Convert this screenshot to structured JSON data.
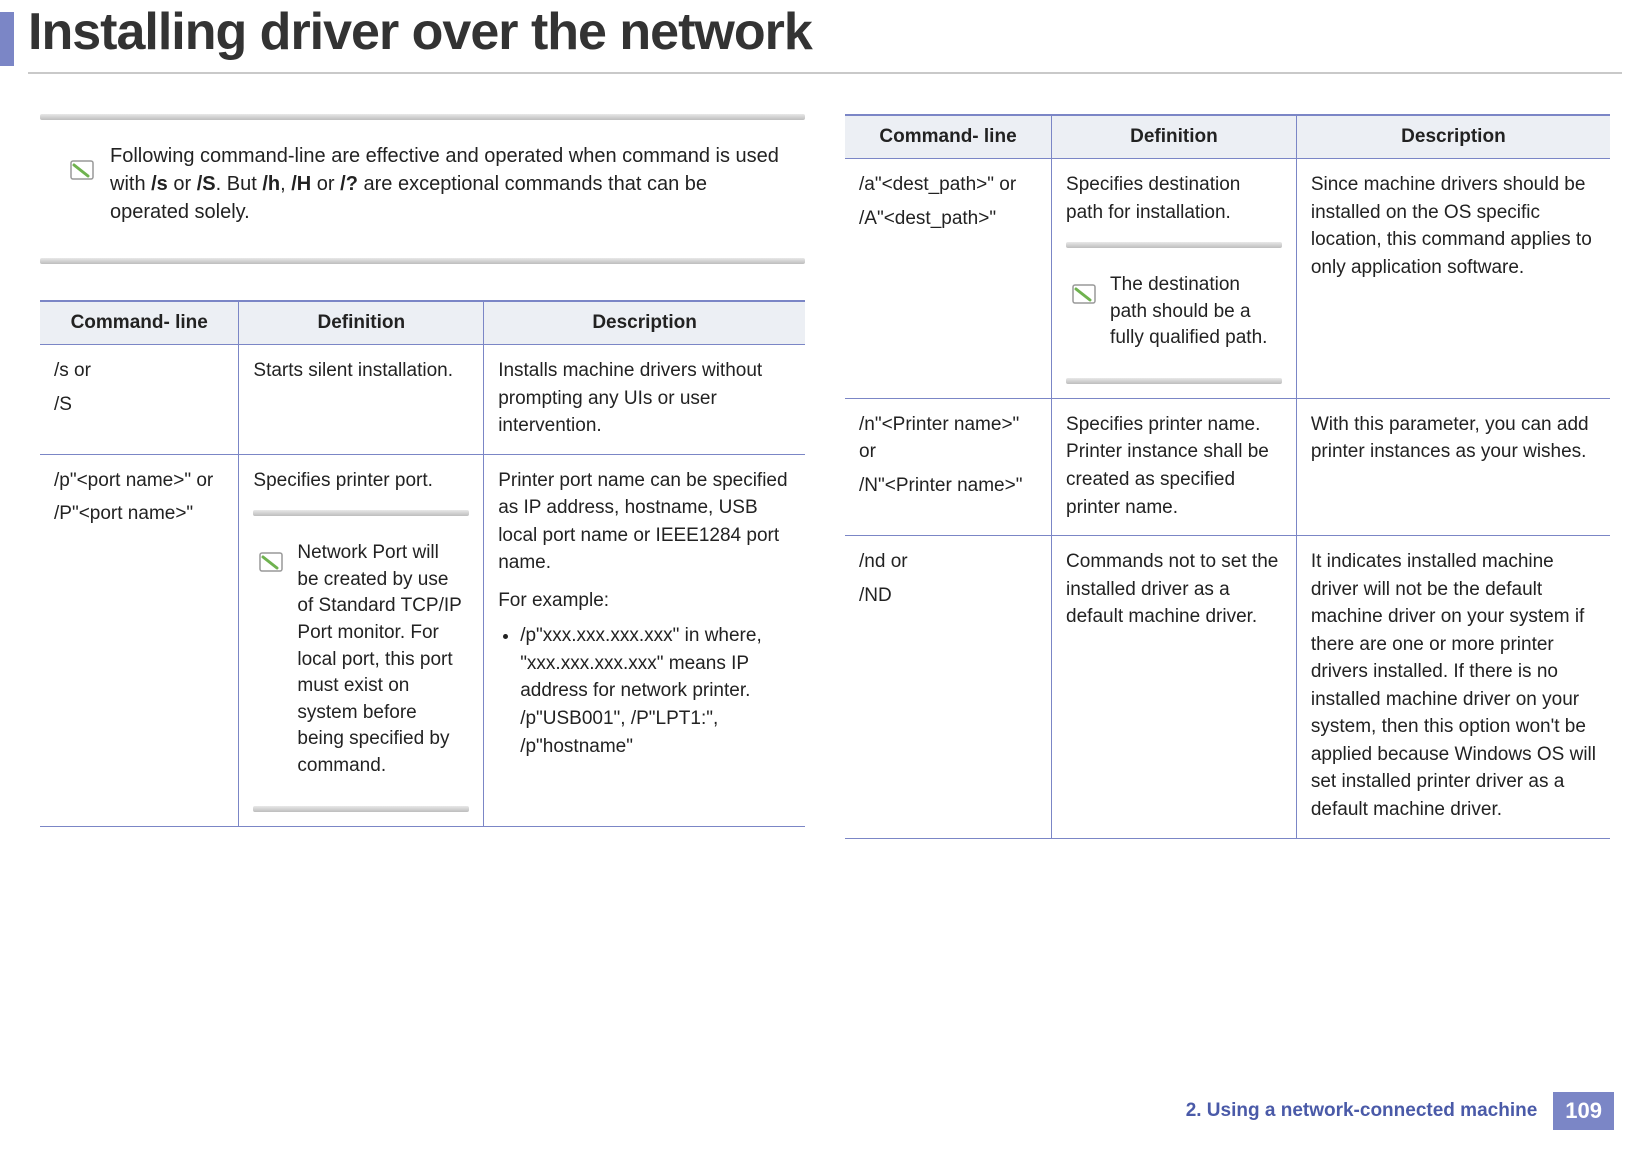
{
  "title": "Installing driver over the network",
  "intro_note": {
    "prefix": "Following command-line are effective and operated when command is used with ",
    "bold1": "/s",
    "mid1": " or ",
    "bold2": "/S",
    "mid2": ". But ",
    "bold3": "/h",
    "mid3": ", ",
    "bold4": "/H",
    "mid4": " or ",
    "bold5": "/?",
    "suffix": " are exceptional commands that can be operated solely."
  },
  "headers": {
    "cmd": "Command- line",
    "def": "Definition",
    "desc": "Description"
  },
  "left_rows": [
    {
      "cmd1": "/s or",
      "cmd2": "/S",
      "def_text": "Starts silent installation.",
      "def_note": null,
      "desc_paras": [
        "Installs machine drivers without prompting any UIs or user intervention."
      ],
      "desc_list": []
    },
    {
      "cmd1": "/p\"<port name>\" or",
      "cmd2": "/P\"<port name>\"",
      "def_text": "Specifies printer port.",
      "def_note": "Network Port will be created by use of Standard TCP/IP Port monitor. For local port, this port must exist on system before being specified by command.",
      "desc_paras": [
        "Printer port name can be specified as IP address, hostname, USB local port name or IEEE1284 port name.",
        "For example:"
      ],
      "desc_list": [
        "/p\"xxx.xxx.xxx.xxx\" in where, \"xxx.xxx.xxx.xxx\" means IP address for network printer. /p\"USB001\", /P\"LPT1:\", /p\"hostname\""
      ]
    }
  ],
  "right_rows": [
    {
      "cmd1": "/a\"<dest_path>\" or",
      "cmd2": "/A\"<dest_path>\"",
      "def_text": "Specifies destination path for installation.",
      "def_note": "The destination path should be a fully qualified path.",
      "desc_paras": [
        "Since machine drivers should be installed on the OS specific location, this command applies to only application software."
      ],
      "desc_list": []
    },
    {
      "cmd1": "/n\"<Printer name>\" or",
      "cmd2": "/N\"<Printer name>\"",
      "def_text": "Specifies printer name. Printer instance shall be created as specified printer name.",
      "def_note": null,
      "desc_paras": [
        "With this parameter, you can add printer instances as your wishes."
      ],
      "desc_list": []
    },
    {
      "cmd1": "/nd or",
      "cmd2": "/ND",
      "def_text": "Commands not to set the installed driver as a default machine driver.",
      "def_note": null,
      "desc_paras": [
        "It indicates installed machine driver will not be the default machine driver on your system if there are one or more printer drivers installed. If there is no installed machine driver on your system, then this option won't be applied because Windows OS will set installed printer driver as a default machine driver."
      ],
      "desc_list": []
    }
  ],
  "footer": {
    "chapter": "2.  Using a network-connected machine",
    "page": "109"
  }
}
